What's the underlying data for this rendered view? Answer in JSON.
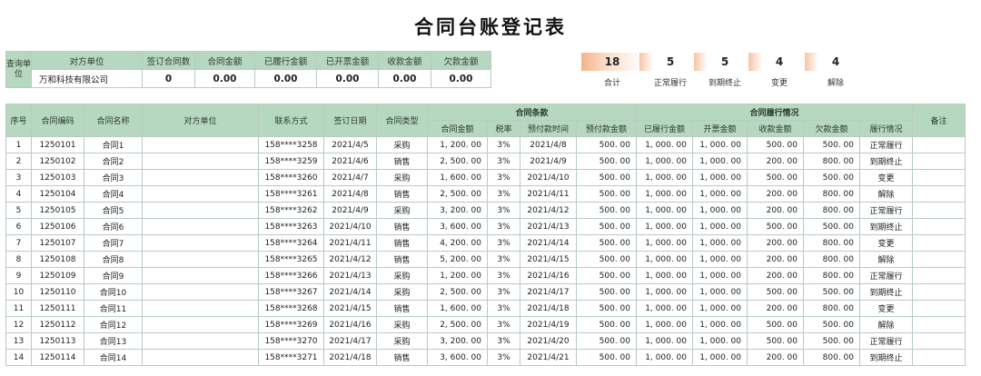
{
  "title": "合同台账登记表",
  "query": {
    "label": "查询单位",
    "headers": [
      "对方单位",
      "签订合同数",
      "合同金额",
      "已履行金额",
      "已开票金额",
      "收款金额",
      "欠款金额"
    ],
    "values": [
      "万和科技有限公司",
      "0",
      "0.00",
      "0.00",
      "0.00",
      "0.00",
      "0.00"
    ]
  },
  "stats": [
    {
      "value": "18",
      "label": "合计"
    },
    {
      "value": "5",
      "label": "正常履行"
    },
    {
      "value": "5",
      "label": "到期终止"
    },
    {
      "value": "4",
      "label": "变更"
    },
    {
      "value": "4",
      "label": "解除"
    }
  ],
  "table": {
    "headers": {
      "seq": "序号",
      "code": "合同编码",
      "name": "合同名称",
      "party": "对方单位",
      "contact": "联系方式",
      "date": "签订日期",
      "type": "合同类型",
      "terms_group": "合同条款",
      "perf_group": "合同履行情况",
      "remark": "备注",
      "terms": [
        "合同金额",
        "税率",
        "预付款时间",
        "预付款金额"
      ],
      "perf": [
        "已履行金额",
        "开票金额",
        "收款金额",
        "欠款金额",
        "履行情况"
      ]
    },
    "rows": [
      [
        "1",
        "1250101",
        "合同1",
        "",
        "158****3258",
        "2021/4/5",
        "采购",
        "1, 200. 00",
        "3%",
        "2021/4/8",
        "500. 00",
        "1, 000. 00",
        "1, 000. 00",
        "500. 00",
        "500. 00",
        "正常履行",
        ""
      ],
      [
        "2",
        "1250102",
        "合同2",
        "",
        "158****3259",
        "2021/4/6",
        "销售",
        "2, 500. 00",
        "3%",
        "2021/4/9",
        "500. 00",
        "1, 000. 00",
        "1, 000. 00",
        "200. 00",
        "800. 00",
        "到期终止",
        ""
      ],
      [
        "3",
        "1250103",
        "合同3",
        "",
        "158****3260",
        "2021/4/7",
        "采购",
        "1, 600. 00",
        "3%",
        "2021/4/10",
        "500. 00",
        "1, 000. 00",
        "1, 000. 00",
        "500. 00",
        "500. 00",
        "变更",
        ""
      ],
      [
        "4",
        "1250104",
        "合同4",
        "",
        "158****3261",
        "2021/4/8",
        "销售",
        "2, 500. 00",
        "3%",
        "2021/4/11",
        "500. 00",
        "1, 000. 00",
        "1, 000. 00",
        "200. 00",
        "800. 00",
        "解除",
        ""
      ],
      [
        "5",
        "1250105",
        "合同5",
        "",
        "158****3262",
        "2021/4/9",
        "采购",
        "3, 200. 00",
        "3%",
        "2021/4/12",
        "500. 00",
        "1, 000. 00",
        "1, 000. 00",
        "200. 00",
        "800. 00",
        "正常履行",
        ""
      ],
      [
        "6",
        "1250106",
        "合同6",
        "",
        "158****3263",
        "2021/4/10",
        "销售",
        "3, 600. 00",
        "3%",
        "2021/4/13",
        "500. 00",
        "1, 000. 00",
        "1, 000. 00",
        "500. 00",
        "500. 00",
        "到期终止",
        ""
      ],
      [
        "7",
        "1250107",
        "合同7",
        "",
        "158****3264",
        "2021/4/11",
        "销售",
        "4, 200. 00",
        "3%",
        "2021/4/14",
        "500. 00",
        "1, 000. 00",
        "1, 000. 00",
        "200. 00",
        "800. 00",
        "变更",
        ""
      ],
      [
        "8",
        "1250108",
        "合同8",
        "",
        "158****3265",
        "2021/4/12",
        "销售",
        "5, 200. 00",
        "3%",
        "2021/4/15",
        "500. 00",
        "1, 000. 00",
        "1, 000. 00",
        "200. 00",
        "800. 00",
        "解除",
        ""
      ],
      [
        "9",
        "1250109",
        "合同9",
        "",
        "158****3266",
        "2021/4/13",
        "采购",
        "1, 200. 00",
        "3%",
        "2021/4/16",
        "500. 00",
        "1, 000. 00",
        "1, 000. 00",
        "200. 00",
        "800. 00",
        "正常履行",
        ""
      ],
      [
        "10",
        "1250110",
        "合同10",
        "",
        "158****3267",
        "2021/4/14",
        "采购",
        "2, 500. 00",
        "3%",
        "2021/4/17",
        "500. 00",
        "1, 000. 00",
        "1, 000. 00",
        "500. 00",
        "500. 00",
        "到期终止",
        ""
      ],
      [
        "11",
        "1250111",
        "合同11",
        "",
        "158****3268",
        "2021/4/15",
        "销售",
        "1, 600. 00",
        "3%",
        "2021/4/18",
        "500. 00",
        "1, 000. 00",
        "1, 000. 00",
        "200. 00",
        "800. 00",
        "变更",
        ""
      ],
      [
        "12",
        "1250112",
        "合同12",
        "",
        "158****3269",
        "2021/4/16",
        "采购",
        "2, 500. 00",
        "3%",
        "2021/4/19",
        "500. 00",
        "1, 000. 00",
        "1, 000. 00",
        "500. 00",
        "500. 00",
        "解除",
        ""
      ],
      [
        "13",
        "1250113",
        "合同13",
        "",
        "158****3270",
        "2021/4/17",
        "采购",
        "3, 200. 00",
        "3%",
        "2021/4/20",
        "500. 00",
        "1, 000. 00",
        "1, 000. 00",
        "500. 00",
        "500. 00",
        "正常履行",
        ""
      ],
      [
        "14",
        "1250114",
        "合同14",
        "",
        "158****3271",
        "2021/4/18",
        "销售",
        "3, 600. 00",
        "3%",
        "2021/4/21",
        "500. 00",
        "1, 000. 00",
        "1, 000. 00",
        "200. 00",
        "800. 00",
        "到期终止",
        ""
      ]
    ]
  }
}
